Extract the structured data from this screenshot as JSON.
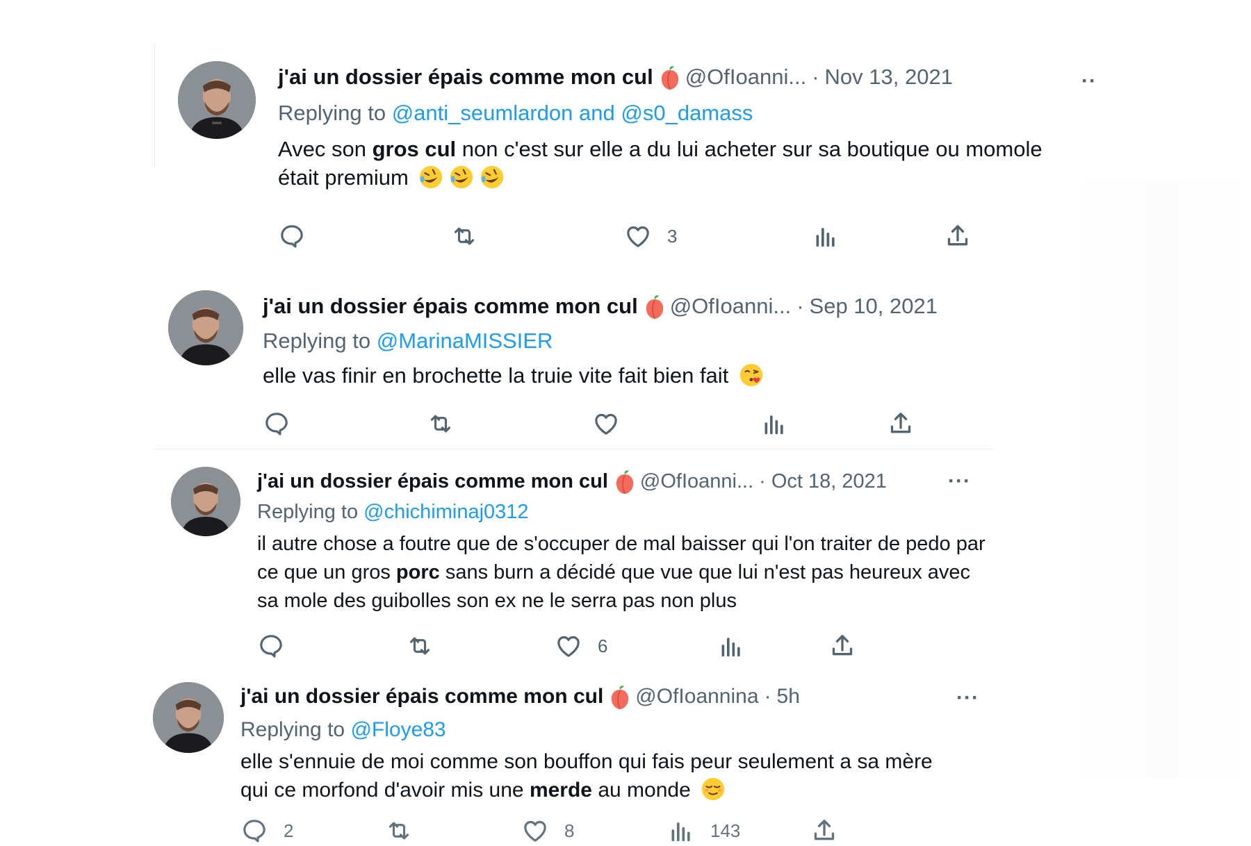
{
  "tweets": [
    {
      "display_name": "j'ai un dossier épais comme mon cul",
      "handle": "@OfIoanni...",
      "dot": "·",
      "timestamp": "Nov 13, 2021",
      "more": "··",
      "replying_prefix": "Replying to",
      "reply_mention_1": "@anti_seumlardon",
      "reply_conjunction": "and",
      "reply_mention_2": "@s0_damass",
      "text_1": "Avec son ",
      "text_bold_1": "gros cul",
      "text_2": " non c'est sur elle a du lui acheter sur sa boutique ou momole était premium",
      "likes": "3"
    },
    {
      "display_name": "j'ai un dossier épais comme mon cul",
      "handle": "@OfIoanni...",
      "dot": "·",
      "timestamp": "Sep 10, 2021",
      "replying_prefix": "Replying to",
      "reply_mention_1": "@MarinaMISSIER",
      "text_1": "elle vas finir en brochette la truie vite fait bien fait"
    },
    {
      "display_name": "j'ai un dossier épais comme mon cul",
      "handle": "@OfIoanni...",
      "dot": "·",
      "timestamp": "Oct 18, 2021",
      "more": "···",
      "replying_prefix": "Replying to",
      "reply_mention_1": "@chichiminaj0312",
      "text_1": "il autre chose a foutre que de s'occuper de mal baisser qui l'on traiter de pedo par ce que un gros ",
      "text_bold_1": "porc",
      "text_2": " sans burn a décidé que vue que lui n'est pas heureux avec sa mole des guibolles son ex ne le serra pas non plus",
      "likes": "6"
    },
    {
      "display_name": "j'ai un dossier épais comme mon cul",
      "handle": "@OfIoannina",
      "dot": "·",
      "timestamp": "5h",
      "more": "···",
      "replying_prefix": "Replying to",
      "reply_mention_1": "@Floye83",
      "text_1": "elle s'ennuie de moi comme son bouffon qui fais peur seulement a sa mère qui ce morfond d'avoir mis une ",
      "text_bold_1": "merde",
      "text_2": " au monde",
      "replies": "2",
      "likes": "8",
      "views": "143"
    }
  ],
  "icons": {
    "reply": "reply-icon",
    "retweet": "retweet-icon",
    "like": "heart-icon",
    "views": "views-icon",
    "share": "share-icon",
    "more": "more-icon",
    "peach": "peach-emoji",
    "laugh": "rolling-on-floor-laughing-emoji",
    "kiss": "face-blowing-kiss-emoji",
    "relieved": "relieved-face-emoji"
  },
  "colors": {
    "text": "#0f1419",
    "secondary": "#536471",
    "accent": "#1d9bf0",
    "separator": "#eceff1"
  }
}
